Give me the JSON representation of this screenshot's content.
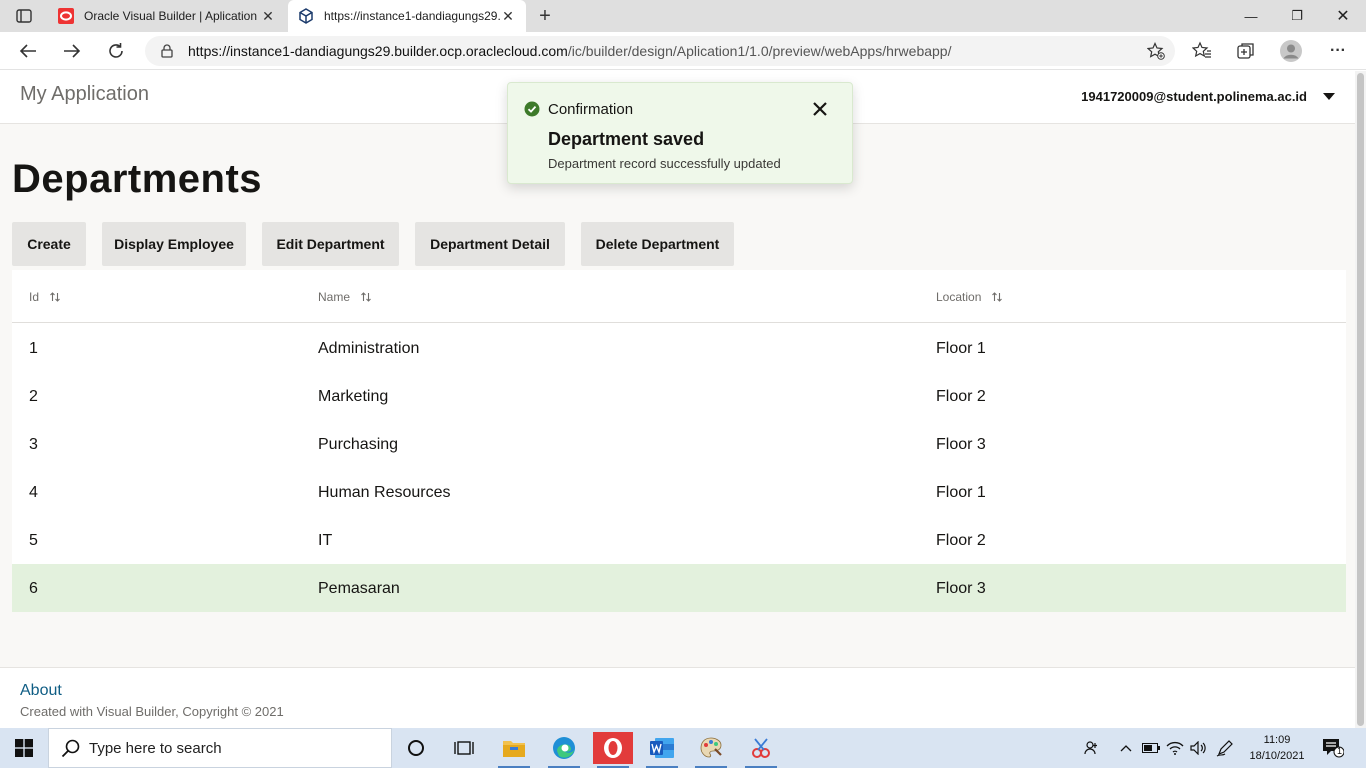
{
  "browser": {
    "tabs": [
      {
        "title": "Oracle Visual Builder | Aplication",
        "active": false,
        "icon": "oracle-icon"
      },
      {
        "title": "https://instance1-dandiagungs29.",
        "active": true,
        "icon": "cube-icon"
      }
    ],
    "url_host": "https://instance1-dandiagungs29.builder.ocp.oraclecloud.com",
    "url_path": "/ic/builder/design/Aplication1/1.0/preview/webApps/hrwebapp/",
    "close_glyph": "✕",
    "new_tab_glyph": "+",
    "minimize_glyph": "—",
    "restore_glyph": "❐",
    "window_close_glyph": "✕",
    "more_glyph": "···"
  },
  "app": {
    "title": "My Application",
    "user": "1941720009@student.polinema.ac.id"
  },
  "page": {
    "title": "Departments",
    "buttons": {
      "create": "Create",
      "display_employee": "Display Employee",
      "edit_department": "Edit Department",
      "department_detail": "Department Detail",
      "delete_department": "Delete Department"
    }
  },
  "table": {
    "columns": {
      "id": "Id",
      "name": "Name",
      "location": "Location"
    },
    "rows": [
      {
        "id": "1",
        "name": "Administration",
        "location": "Floor 1"
      },
      {
        "id": "2",
        "name": "Marketing",
        "location": "Floor 2"
      },
      {
        "id": "3",
        "name": "Purchasing",
        "location": "Floor 3"
      },
      {
        "id": "4",
        "name": "Human Resources",
        "location": "Floor 1"
      },
      {
        "id": "5",
        "name": "IT",
        "location": "Floor 2"
      },
      {
        "id": "6",
        "name": "Pemasaran",
        "location": "Floor 3",
        "selected": true
      }
    ]
  },
  "toast": {
    "category": "Confirmation",
    "summary": "Department saved",
    "detail": "Department record successfully updated"
  },
  "footer": {
    "about": "About",
    "copyright": "Created with Visual Builder, Copyright © 2021"
  },
  "taskbar": {
    "search_placeholder": "Type here to search",
    "time": "11:09",
    "date": "18/10/2021",
    "notification_count": "1"
  },
  "colors": {
    "selected_row": "#e3f1dd",
    "toast_bg": "#eff8ea",
    "success": "#3d7a2a",
    "link": "#0f5d84",
    "taskbar": "#d9e4f2"
  }
}
